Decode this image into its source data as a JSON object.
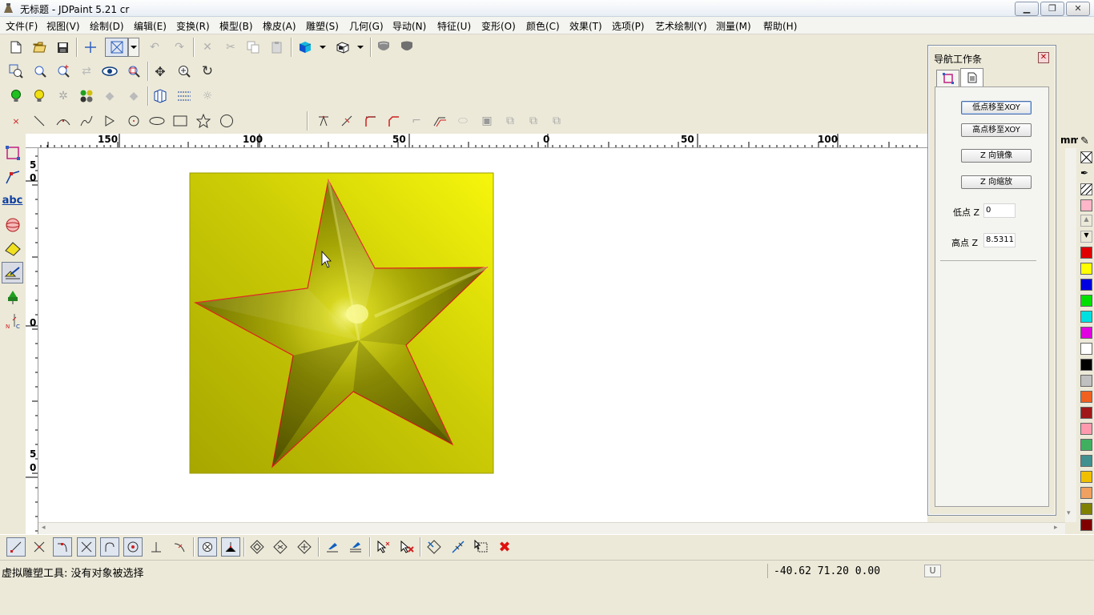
{
  "window": {
    "title": "无标题 - JDPaint 5.21 cr",
    "buttons": {
      "minimize": "▁",
      "restore": "❐",
      "close": "✕"
    }
  },
  "menu": [
    "文件(F)",
    "视图(V)",
    "绘制(D)",
    "编辑(E)",
    "变换(R)",
    "模型(B)",
    "橡皮(A)",
    "雕塑(S)",
    "几何(G)",
    "导动(N)",
    "特征(U)",
    "变形(O)",
    "颜色(C)",
    "效果(T)",
    "选项(P)",
    "艺术绘制(Y)",
    "测量(M)",
    "帮助(H)"
  ],
  "ruler": {
    "h_labels": [
      "150",
      "100",
      "50",
      "0",
      "50",
      "100"
    ],
    "unit": "mm",
    "v_labels": [
      "5",
      "0",
      "0",
      "5",
      "0"
    ]
  },
  "nav_panel": {
    "title": "导航工作条",
    "close_label": "✕",
    "buttons": [
      "低点移至XOY",
      "高点移至XOY",
      "Z 向镜像",
      "Z 向缩放"
    ],
    "low_label": "低点 Z",
    "low_value": "0",
    "high_label": "高点 Z",
    "high_value": "8.5311"
  },
  "palette": {
    "colors": [
      "#ffb6c8",
      "#e00000",
      "#ffff00",
      "#0000e0",
      "#00e000",
      "#00e0e0",
      "#e000e0",
      "#ffffff",
      "#000000",
      "#c0c0c0",
      "#f06020",
      "#a01818",
      "#ff9aae",
      "#40b060",
      "#409090",
      "#f0c000",
      "#f0a060",
      "#808000",
      "#800000"
    ]
  },
  "status": {
    "message": "虚拟雕塑工具: 没有对象被选择",
    "coords": "-40.62  71.20  0.00",
    "unit_indicator": "U"
  },
  "colors": {
    "star_edge": "#e02020",
    "bg_light": "#f4f40a",
    "bg_dark": "#a6a600"
  }
}
